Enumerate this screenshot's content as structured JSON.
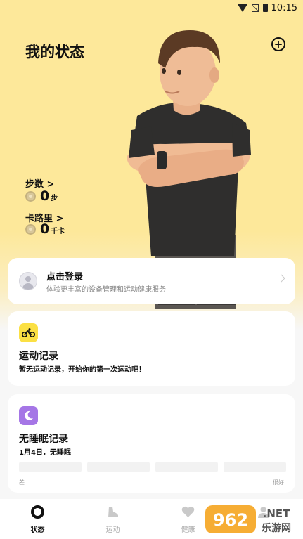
{
  "status": {
    "time": "10:15"
  },
  "header": {
    "title": "我的状态",
    "add_icon": "plus-circle-icon"
  },
  "metrics": {
    "steps": {
      "label": "步数 >",
      "value": "0",
      "unit": "步"
    },
    "calories": {
      "label": "卡路里 >",
      "value": "0",
      "unit": "千卡"
    }
  },
  "login": {
    "title": "点击登录",
    "subtitle": "体验更丰富的设备管理和运动健康服务"
  },
  "sport": {
    "title": "运动记录",
    "subtitle": "暂无运动记录，开始你的第一次运动吧！",
    "icon": "cycling-icon",
    "icon_color": "#fbe044"
  },
  "sleep": {
    "title": "无睡眠记录",
    "subtitle": "1月4日，无睡眠",
    "icon": "moon-icon",
    "icon_color": "#a576e6",
    "scale_low": "差",
    "scale_high": "很好"
  },
  "tabs": [
    {
      "label": "状态",
      "icon": "status-ring-icon",
      "active": true
    },
    {
      "label": "运动",
      "icon": "shoe-icon",
      "active": false
    },
    {
      "label": "健康",
      "icon": "heart-icon",
      "active": false
    },
    {
      "label": "",
      "icon": "profile-icon",
      "active": false
    }
  ],
  "watermark": {
    "number": "962",
    "suffix": ".NET",
    "text": "乐游网"
  },
  "colors": {
    "hero_bg": "#fde89a",
    "accent_yellow": "#fbe044",
    "accent_purple": "#a576e6"
  }
}
